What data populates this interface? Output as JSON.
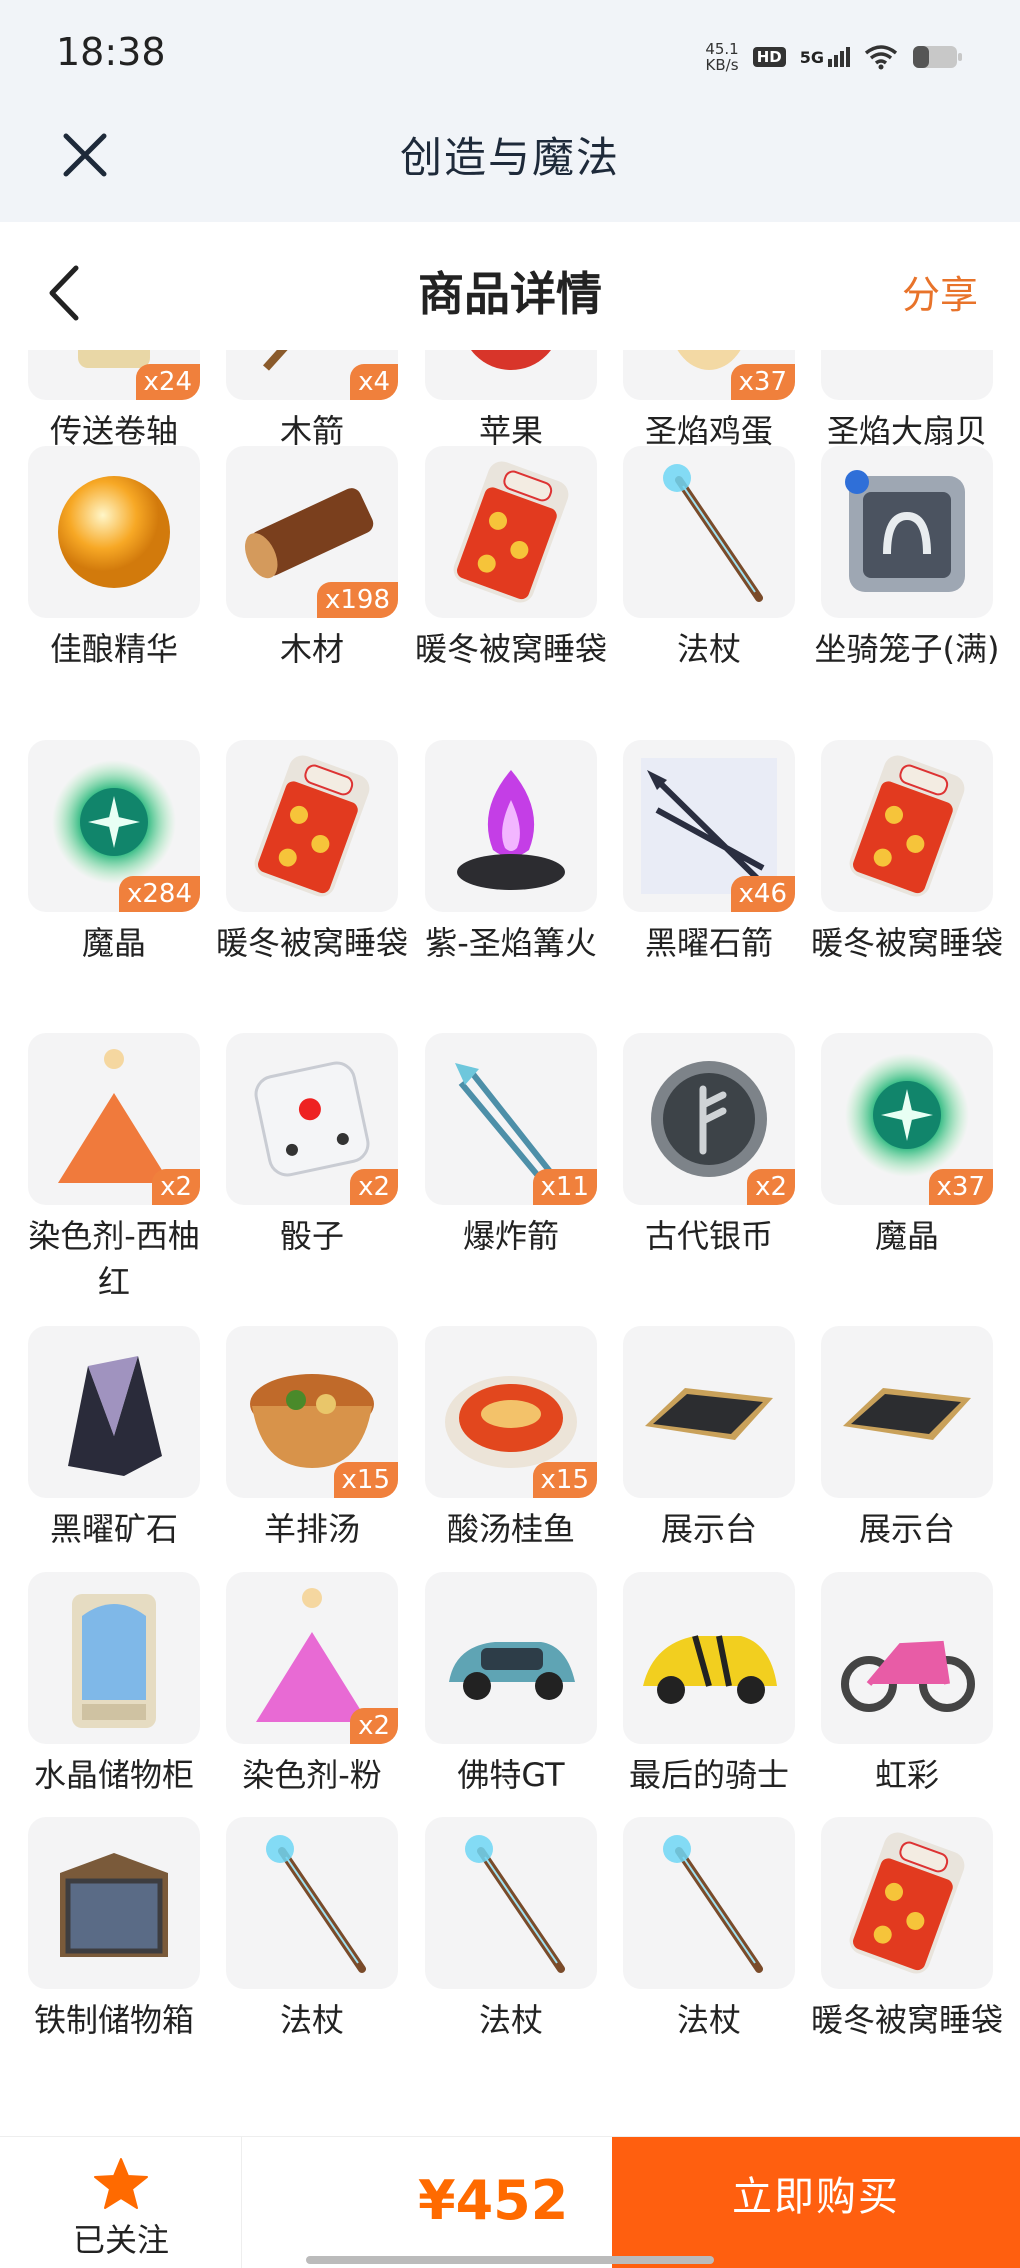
{
  "status": {
    "time": "18:38",
    "net_speed": "45.1",
    "net_unit": "KB/s",
    "hd": "HD",
    "signal": "5G"
  },
  "app": {
    "title": "创造与魔法"
  },
  "nav": {
    "title": "商品详情",
    "share": "分享"
  },
  "colors": {
    "accent": "#ff5f0f",
    "price": "#ff6a00",
    "badge": "#f0803c",
    "tile": "#f4f4f5"
  },
  "items": [
    {
      "name": "传送卷轴",
      "qty": "x24",
      "icon": "scroll-icon"
    },
    {
      "name": "木箭",
      "qty": "x4",
      "icon": "arrow-icon"
    },
    {
      "name": "苹果",
      "qty": "",
      "icon": "apple-icon"
    },
    {
      "name": "圣焰鸡蛋",
      "qty": "x37",
      "icon": "egg-icon"
    },
    {
      "name": "圣焰大扇贝",
      "qty": "",
      "icon": "scallop-icon"
    },
    {
      "name": "佳酿精华",
      "qty": "",
      "icon": "orb-icon"
    },
    {
      "name": "木材",
      "qty": "x198",
      "icon": "log-icon"
    },
    {
      "name": "暖冬被窝睡袋",
      "qty": "",
      "icon": "sleeping-bag-icon"
    },
    {
      "name": "法杖",
      "qty": "",
      "icon": "staff-icon"
    },
    {
      "name": "坐骑笼子(满)",
      "qty": "",
      "icon": "cage-icon"
    },
    {
      "name": "魔晶",
      "qty": "x284",
      "icon": "magic-crystal-icon"
    },
    {
      "name": "暖冬被窝睡袋",
      "qty": "",
      "icon": "sleeping-bag-icon"
    },
    {
      "name": "紫-圣焰篝火",
      "qty": "",
      "icon": "campfire-icon"
    },
    {
      "name": "黑曜石箭",
      "qty": "x46",
      "icon": "obsidian-arrow-icon"
    },
    {
      "name": "暖冬被窝睡袋",
      "qty": "",
      "icon": "sleeping-bag-icon"
    },
    {
      "name": "染色剂-西柚红",
      "qty": "x2",
      "icon": "dye-orange-icon"
    },
    {
      "name": "骰子",
      "qty": "x2",
      "icon": "dice-icon"
    },
    {
      "name": "爆炸箭",
      "qty": "x11",
      "icon": "explosive-arrow-icon"
    },
    {
      "name": "古代银币",
      "qty": "x2",
      "icon": "coin-icon"
    },
    {
      "name": "魔晶",
      "qty": "x37",
      "icon": "magic-crystal-icon"
    },
    {
      "name": "黑曜矿石",
      "qty": "",
      "icon": "obsidian-ore-icon"
    },
    {
      "name": "羊排汤",
      "qty": "x15",
      "icon": "soup-icon"
    },
    {
      "name": "酸汤桂鱼",
      "qty": "x15",
      "icon": "fish-dish-icon"
    },
    {
      "name": "展示台",
      "qty": "",
      "icon": "display-stand-icon"
    },
    {
      "name": "展示台",
      "qty": "",
      "icon": "display-stand-icon"
    },
    {
      "name": "水晶储物柜",
      "qty": "",
      "icon": "crystal-cabinet-icon"
    },
    {
      "name": "染色剂-粉",
      "qty": "x2",
      "icon": "dye-pink-icon"
    },
    {
      "name": "佛特GT",
      "qty": "",
      "icon": "car-blue-icon"
    },
    {
      "name": "最后的骑士",
      "qty": "",
      "icon": "car-yellow-icon"
    },
    {
      "name": "虹彩",
      "qty": "",
      "icon": "motorcycle-icon"
    },
    {
      "name": "铁制储物箱",
      "qty": "",
      "icon": "iron-chest-icon"
    },
    {
      "name": "法杖",
      "qty": "",
      "icon": "staff-icon"
    },
    {
      "name": "法杖",
      "qty": "",
      "icon": "staff-icon"
    },
    {
      "name": "法杖",
      "qty": "",
      "icon": "staff-icon"
    },
    {
      "name": "暖冬被窝睡袋",
      "qty": "",
      "icon": "sleeping-bag-icon"
    }
  ],
  "footer": {
    "follow_label": "已关注",
    "price": "¥452",
    "buy_label": "立即购买"
  }
}
